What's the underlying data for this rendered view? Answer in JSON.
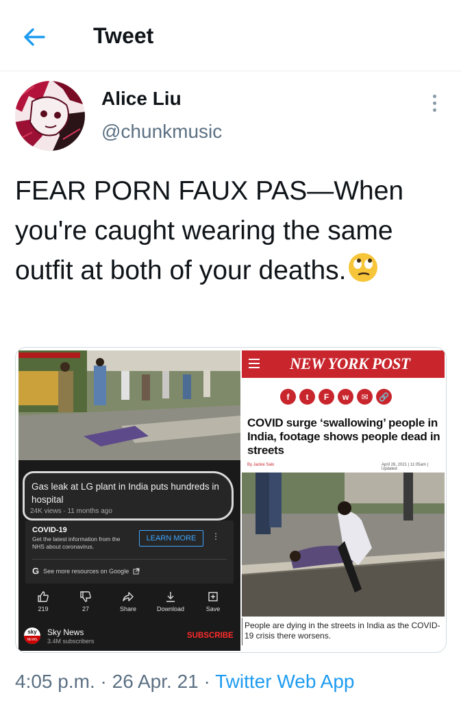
{
  "header": {
    "title": "Tweet"
  },
  "author": {
    "name": "Alice Liu",
    "handle": "@chunkmusic"
  },
  "tweet": {
    "text": "FEAR PORN FAUX PAS—When you're caught wearing the same outfit at both of your deaths.",
    "emoji": "face-with-rolling-eyes"
  },
  "media": {
    "youtube": {
      "title": "Gas leak at LG plant in India puts hundreds in hospital",
      "meta": "24K views · 11 months ago",
      "covid_title": "COVID-19",
      "covid_text": "Get the latest information from the NHS about coronavirus.",
      "learn_more": "LEARN MORE",
      "google_text": "See more resources on Google",
      "actions": [
        {
          "icon": "thumbs-up-icon",
          "label": "219"
        },
        {
          "icon": "thumbs-down-icon",
          "label": "27"
        },
        {
          "icon": "share-icon",
          "label": "Share"
        },
        {
          "icon": "download-icon",
          "label": "Download"
        },
        {
          "icon": "save-icon",
          "label": "Save"
        }
      ],
      "channel_name": "Sky News",
      "channel_subs": "3.4M subscribers",
      "subscribe": "SUBSCRIBE",
      "logo_top": "sky",
      "logo_bottom": "NEWS"
    },
    "nypost": {
      "logo": "NEW YORK POST",
      "share_icons": [
        "f",
        "t",
        "F",
        "w",
        "✉",
        "🔗"
      ],
      "headline": "COVID surge ‘swallowing’ people in India, footage shows people dead in streets",
      "byline": "By Jackie Salo",
      "date": "April 26, 2021 | 11:05am | Updated",
      "caption": "People are dying in the streets in India as the COVID-19 crisis there worsens."
    }
  },
  "footer": {
    "time": "4:05 p.m.",
    "date": "26 Apr. 21",
    "app": "Twitter Web App"
  },
  "colors": {
    "accent": "#1d9bf0",
    "secondary_text": "#5b7083",
    "nypost_red": "#c8252d",
    "youtube_red": "#ff2b2b"
  }
}
